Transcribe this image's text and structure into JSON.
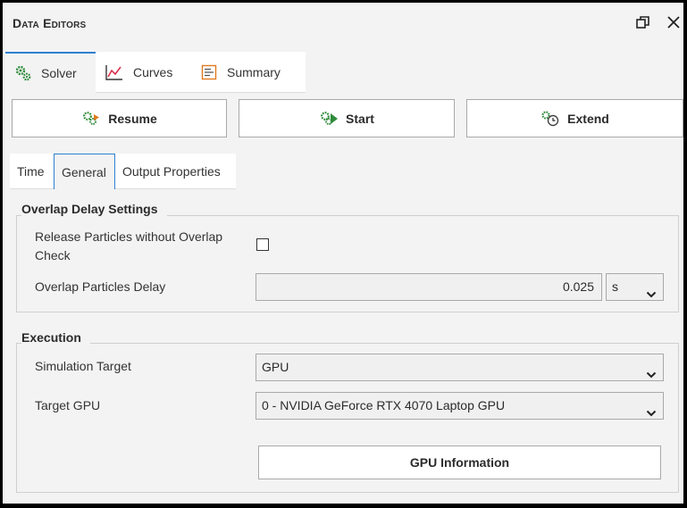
{
  "window": {
    "title": "Data Editors"
  },
  "tabs": {
    "solver": "Solver",
    "curves": "Curves",
    "summary": "Summary"
  },
  "actions": {
    "resume": "Resume",
    "start": "Start",
    "extend": "Extend"
  },
  "subtabs": {
    "time": "Time",
    "general": "General",
    "output": "Output Properties"
  },
  "overlap": {
    "title": "Overlap Delay Settings",
    "release_label_line1": "Release Particles without Overlap",
    "release_label_line2": "Check",
    "release_checked": false,
    "delay_label": "Overlap Particles Delay",
    "delay_value": "0.025",
    "delay_unit": "s"
  },
  "execution": {
    "title": "Execution",
    "target_label": "Simulation Target",
    "target_value": "GPU",
    "gpu_label": "Target GPU",
    "gpu_value": "0 - NVIDIA GeForce RTX 4070 Laptop GPU",
    "gpu_info_button": "GPU Information"
  },
  "colors": {
    "accent": "#2f80d1",
    "gear_green": "#2e8b3a",
    "arrow_orange": "#e07a1f",
    "curve_red": "#d9304a"
  }
}
